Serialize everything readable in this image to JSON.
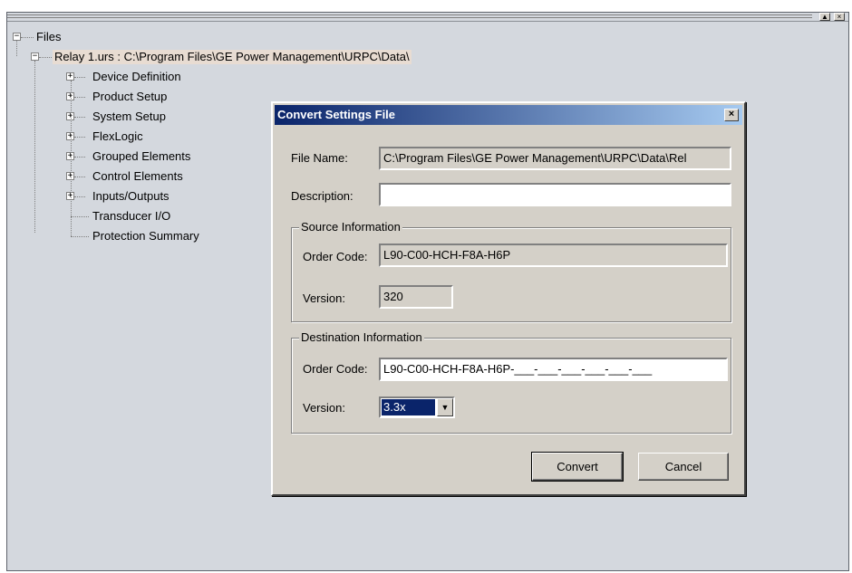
{
  "tree": {
    "root": "Files",
    "file": "Relay 1.urs : C:\\Program Files\\GE Power Management\\URPC\\Data\\",
    "items": [
      {
        "label": "Device Definition",
        "expandable": true
      },
      {
        "label": "Product Setup",
        "expandable": true
      },
      {
        "label": "System Setup",
        "expandable": true
      },
      {
        "label": "FlexLogic",
        "expandable": true
      },
      {
        "label": "Grouped Elements",
        "expandable": true
      },
      {
        "label": "Control Elements",
        "expandable": true
      },
      {
        "label": "Inputs/Outputs",
        "expandable": true
      },
      {
        "label": "Transducer I/O",
        "expandable": false
      },
      {
        "label": "Protection Summary",
        "expandable": false
      }
    ],
    "expand_glyph": "+",
    "collapse_glyph": "−"
  },
  "window_controls": {
    "minimize": "▲",
    "close": "×"
  },
  "dialog": {
    "title": "Convert Settings File",
    "close_glyph": "×",
    "file_name_label": "File Name:",
    "file_name_value": "C:\\Program Files\\GE Power Management\\URPC\\Data\\Rel",
    "description_label": "Description:",
    "description_value": "",
    "source": {
      "title": "Source Information",
      "order_code_label": "Order Code:",
      "order_code_value": "L90-C00-HCH-F8A-H6P",
      "version_label": "Version:",
      "version_value": "320"
    },
    "destination": {
      "title": "Destination Information",
      "order_code_label": "Order Code:",
      "order_code_value": "L90-C00-HCH-F8A-H6P-___-___-___-___-___-___",
      "version_label": "Version:",
      "version_value": "3.3x",
      "dropdown_glyph": "▼"
    },
    "convert_label": "Convert",
    "cancel_label": "Cancel"
  },
  "colors": {
    "title_start": "#0a246a",
    "title_end": "#a6caf0",
    "dialog_bg": "#d4d0c8",
    "pane_bg": "#d4d8de"
  }
}
